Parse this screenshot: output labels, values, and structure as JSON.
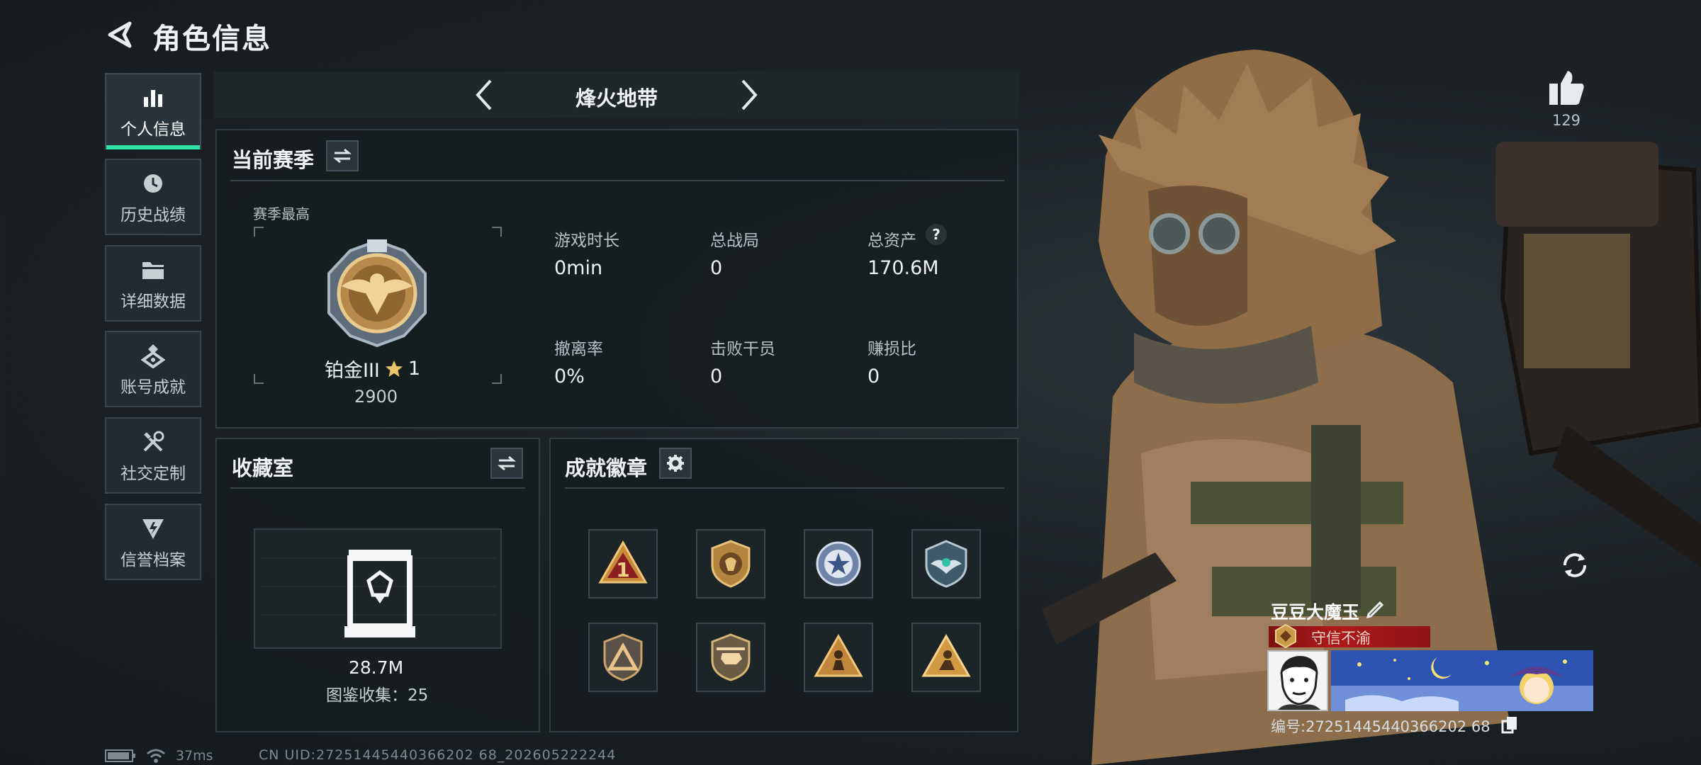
{
  "header": {
    "title": "角色信息"
  },
  "nav": [
    {
      "label": "个人信息",
      "icon": "bar-chart-icon"
    },
    {
      "label": "历史战绩",
      "icon": "history-icon"
    },
    {
      "label": "详细数据",
      "icon": "folder-icon"
    },
    {
      "label": "账号成就",
      "icon": "achievement-icon"
    },
    {
      "label": "社交定制",
      "icon": "tools-icon"
    },
    {
      "label": "信誉档案",
      "icon": "reputation-icon"
    }
  ],
  "mode": {
    "label": "烽火地带"
  },
  "season": {
    "title": "当前赛季",
    "best_label": "赛季最高",
    "rank_name": "铂金III",
    "rank_stars": "1",
    "rank_score": "2900",
    "stats": [
      {
        "label": "游戏时长",
        "value": "0min"
      },
      {
        "label": "总战局",
        "value": "0"
      },
      {
        "label": "总资产",
        "value": "170.6M"
      },
      {
        "label": "撤离率",
        "value": "0%"
      },
      {
        "label": "击败干员",
        "value": "0"
      },
      {
        "label": "赚损比",
        "value": "0"
      }
    ],
    "help_mark": "?"
  },
  "collection": {
    "title": "收藏室",
    "value": "28.7M",
    "catalog": "图鉴收集：25"
  },
  "achievements": {
    "title": "成就徽章",
    "badges": [
      "rank-one-badge-icon",
      "lion-shield-badge-icon",
      "star-emblem-badge-icon",
      "wings-emblem-badge-icon",
      "triangle-shield-badge-icon",
      "helicopter-badge-icon",
      "soldier-triangle-badge-icon",
      "soldier-triangle-gold-badge-icon"
    ]
  },
  "profile": {
    "likes": "129",
    "player_name": "豆豆大魔玉",
    "honor_label": "守信不渝",
    "player_id": "编号:27251445440366202 68"
  },
  "status": {
    "ping": "37ms",
    "cn_uid": "CN UID:27251445440366202 68_202605222244"
  },
  "colors": {
    "accent": "#2ee3a5",
    "honor_red": "#b01818",
    "gold": "#c99a4a"
  }
}
